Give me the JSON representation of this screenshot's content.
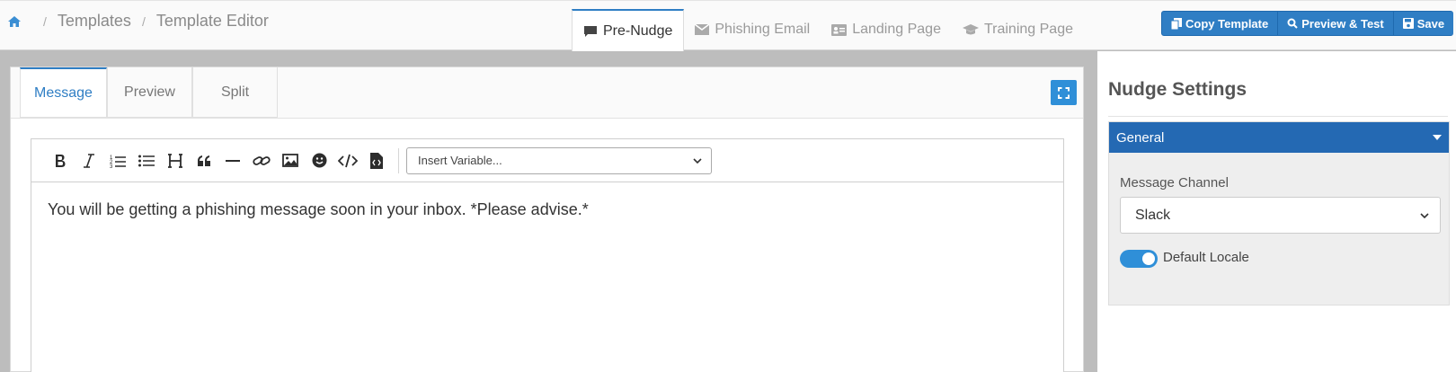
{
  "breadcrumb": {
    "items": [
      "Templates",
      "Template Editor"
    ],
    "separator": "/"
  },
  "top_tabs": [
    {
      "label": "Pre-Nudge",
      "icon": "comment-icon",
      "active": true
    },
    {
      "label": "Phishing Email",
      "icon": "envelope-icon",
      "active": false
    },
    {
      "label": "Landing Page",
      "icon": "id-card-icon",
      "active": false
    },
    {
      "label": "Training Page",
      "icon": "graduation-cap-icon",
      "active": false
    }
  ],
  "actions": {
    "copy": "Copy Template",
    "preview": "Preview & Test",
    "save": "Save"
  },
  "editor_tabs": [
    "Message",
    "Preview",
    "Split"
  ],
  "active_editor_tab": "Message",
  "toolbar": {
    "buttons": [
      "bold-icon",
      "italic-icon",
      "ordered-list-icon",
      "unordered-list-icon",
      "heading-icon",
      "quote-icon",
      "horizontal-rule-icon",
      "link-icon",
      "image-icon",
      "emoji-icon",
      "code-icon",
      "file-code-icon"
    ],
    "insert_variable_placeholder": "Insert Variable..."
  },
  "editor_content": "You will be getting a phishing message soon in your inbox. *Please advise.*",
  "settings": {
    "title": "Nudge Settings",
    "section_title": "General",
    "channel_label": "Message Channel",
    "channel_value": "Slack",
    "default_locale_label": "Default Locale",
    "default_locale_enabled": true
  },
  "colors": {
    "accent": "#2f7ec4",
    "section_header": "#2469b3"
  }
}
